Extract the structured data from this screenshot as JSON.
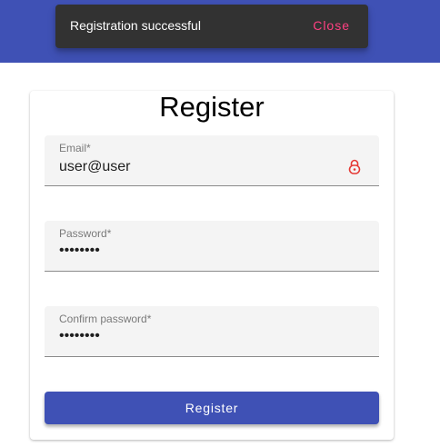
{
  "snackbar": {
    "message": "Registration successful",
    "action": "Close"
  },
  "form": {
    "title": "Register",
    "email": {
      "label": "Email*",
      "value": "user@user",
      "icon": "lock-icon"
    },
    "password": {
      "label": "Password*",
      "value": "••••••••"
    },
    "confirm_password": {
      "label": "Confirm password*",
      "value": "••••••••"
    },
    "submit_label": "Register"
  },
  "colors": {
    "primary": "#3f51b5",
    "snackbar": "#323232",
    "accent": "#ff4081",
    "warn": "#e53935"
  }
}
